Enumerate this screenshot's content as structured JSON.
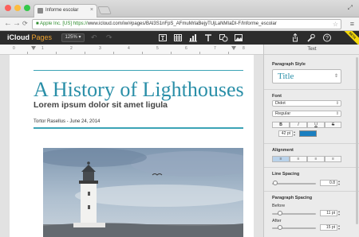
{
  "browser": {
    "tab_title": "Informe escolar",
    "tab_close": "×",
    "resize": "⤢",
    "back": "←",
    "forward": "→",
    "reload": "C",
    "ev_label": "Apple Inc. [US]",
    "url_scheme": "https://",
    "url_rest": "www.icloud.com/iw/#pages/BAl3S1nFpS_AFmuMrlaBejyTUjLaNMIaDI-F/Informe_escolar",
    "star": "☆",
    "menu": "≡"
  },
  "app": {
    "brand": "iCloud",
    "product": "Pages",
    "zoom": "125%",
    "undo": "↶",
    "redo": "↷",
    "flag_label": "BETA",
    "toolbar_icons": [
      "paragraph-icon",
      "table-icon",
      "chart-icon",
      "text-icon",
      "shape-icon",
      "image-icon"
    ],
    "right_icons": [
      "share-icon",
      "tools-icon",
      "help-icon"
    ]
  },
  "ruler": {
    "labels": [
      "0",
      "1",
      "2",
      "3",
      "4",
      "5",
      "6",
      "7",
      "8"
    ]
  },
  "document": {
    "title": "A History of Lighthouses",
    "subtitle": "Lorem ipsum dolor sit amet ligula",
    "byline": "Tortor Rasellus - June 24, 2014"
  },
  "sidebar": {
    "header": "Text",
    "paragraph_style_label": "Paragraph Style",
    "paragraph_style": "Title",
    "font_label": "Font",
    "font_family": "Didot",
    "font_weight": "Regular",
    "bold": "B",
    "italic": "I",
    "underline": "U",
    "strike": "S",
    "font_size": "42 pt",
    "color": "#1a7fc0",
    "alignment_label": "Alignment",
    "alignment_active": "left",
    "line_spacing_label": "Line Spacing",
    "line_spacing": "0.8",
    "line_spacing_level": 0.05,
    "paragraph_spacing_label": "Paragraph Spacing",
    "before_label": "Before",
    "before_value": "11 pt",
    "before_level": 0.15,
    "after_label": "After",
    "after_value": "15 pt",
    "after_level": 0.15
  }
}
